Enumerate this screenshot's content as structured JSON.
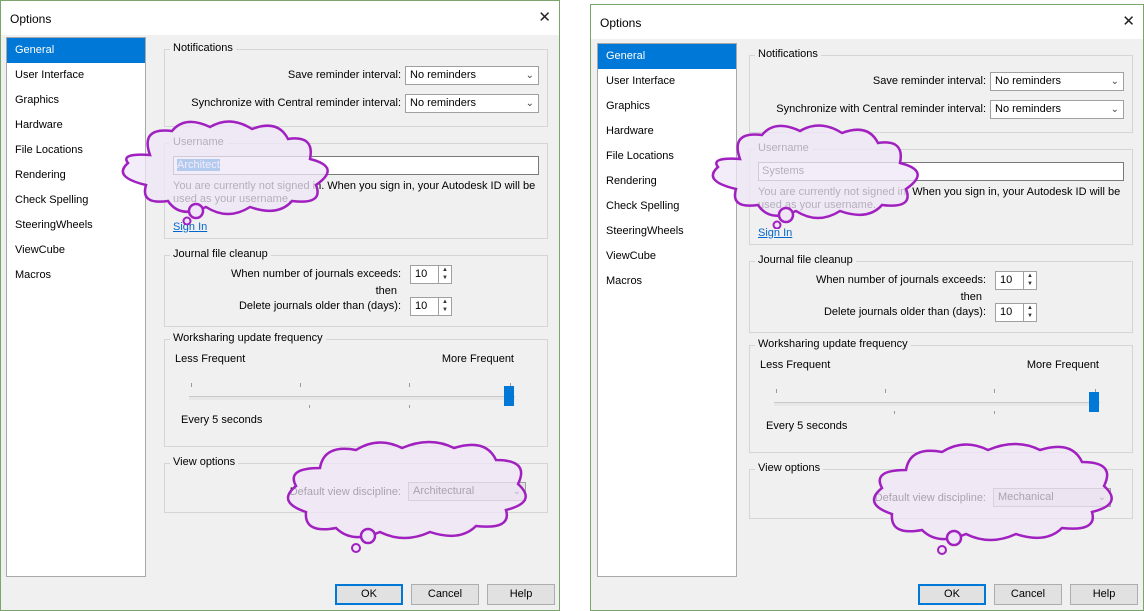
{
  "dialogs": [
    {
      "title": "Options",
      "close_glyph": "✕",
      "nav_items": [
        "General",
        "User Interface",
        "Graphics",
        "Hardware",
        "File Locations",
        "Rendering",
        "Check Spelling",
        "SteeringWheels",
        "ViewCube",
        "Macros"
      ],
      "selected_nav": "General",
      "notifications": {
        "group_label": "Notifications",
        "save_label": "Save reminder interval:",
        "save_value": "No reminders",
        "sync_label": "Synchronize with Central reminder interval:",
        "sync_value": "No reminders"
      },
      "username": {
        "group_label": "Username",
        "value": "Architect",
        "note": "You are currently not signed in. When you sign in, your Autodesk ID will be used as your username.",
        "sign_in": "Sign In"
      },
      "journal": {
        "group_label": "Journal file cleanup",
        "exceeds_label": "When number of journals exceeds:",
        "exceeds_value": "10",
        "then_label": "then",
        "older_label": "Delete journals older than (days):",
        "older_value": "10"
      },
      "worksharing": {
        "group_label": "Worksharing update frequency",
        "less_label": "Less Frequent",
        "more_label": "More Frequent",
        "status": "Every 5 seconds",
        "slider_level": 1.0
      },
      "view_options": {
        "group_label": "View options",
        "discipline_label": "Default view discipline:",
        "discipline_value": "Architectural"
      },
      "buttons": {
        "ok": "OK",
        "cancel": "Cancel",
        "help": "Help"
      }
    },
    {
      "title": "Options",
      "close_glyph": "✕",
      "nav_items": [
        "General",
        "User Interface",
        "Graphics",
        "Hardware",
        "File Locations",
        "Rendering",
        "Check Spelling",
        "SteeringWheels",
        "ViewCube",
        "Macros"
      ],
      "selected_nav": "General",
      "notifications": {
        "group_label": "Notifications",
        "save_label": "Save reminder interval:",
        "save_value": "No reminders",
        "sync_label": "Synchronize with Central reminder interval:",
        "sync_value": "No reminders"
      },
      "username": {
        "group_label": "Username",
        "value": "Systems",
        "note": "You are currently not signed in. When you sign in, your Autodesk ID will be used as your username.",
        "sign_in": "Sign In"
      },
      "journal": {
        "group_label": "Journal file cleanup",
        "exceeds_label": "When number of journals exceeds:",
        "exceeds_value": "10",
        "then_label": "then",
        "older_label": "Delete journals older than (days):",
        "older_value": "10"
      },
      "worksharing": {
        "group_label": "Worksharing update frequency",
        "less_label": "Less Frequent",
        "more_label": "More Frequent",
        "status": "Every 5 seconds",
        "slider_level": 1.0
      },
      "view_options": {
        "group_label": "View options",
        "discipline_label": "Default view discipline:",
        "discipline_value": "Mechanical"
      },
      "buttons": {
        "ok": "OK",
        "cancel": "Cancel",
        "help": "Help"
      }
    }
  ],
  "annotation_colors": {
    "cloud_stroke": "#a020c0",
    "cloud_fill": "#efe6f7"
  }
}
